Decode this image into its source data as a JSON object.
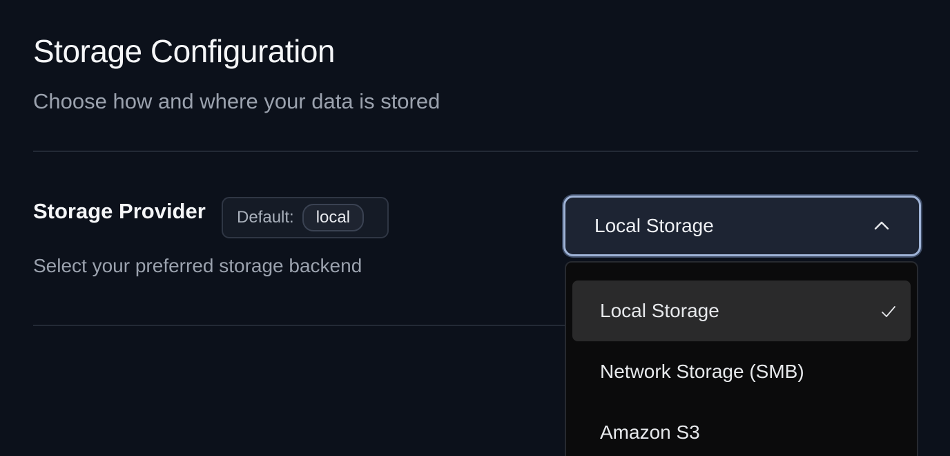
{
  "header": {
    "title": "Storage Configuration",
    "subtitle": "Choose how and where your data is stored"
  },
  "storage_provider": {
    "label": "Storage Provider",
    "default_key": "Default:",
    "default_value": "local",
    "help": "Select your preferred storage backend",
    "selected_value": "Local Storage",
    "options": [
      {
        "label": "Local Storage",
        "selected": true
      },
      {
        "label": "Network Storage (SMB)",
        "selected": false
      },
      {
        "label": "Amazon S3",
        "selected": false
      }
    ]
  },
  "icons": {
    "dropdown_chevron": "chevron-up-icon",
    "selected_marker": "check-icon"
  },
  "colors": {
    "background": "#0c111b",
    "focus_ring": "#9fb3d6",
    "selected_option_bg": "#2a2a2b"
  }
}
